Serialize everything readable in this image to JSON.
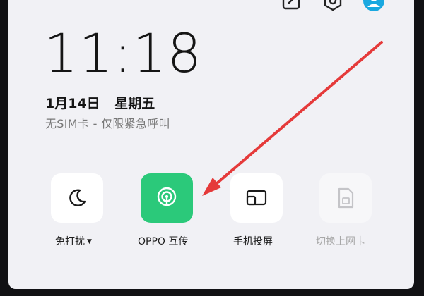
{
  "clock": {
    "time": "11:18"
  },
  "date": {
    "day": "1月14日",
    "weekday": "星期五"
  },
  "status": {
    "sim": "无SIM卡 - 仅限紧急呼叫"
  },
  "tiles": [
    {
      "label": "免打扰",
      "icon": "moon-icon",
      "has_dropdown": true,
      "enabled": true,
      "active": false
    },
    {
      "label": "OPPO 互传",
      "icon": "oppo-share-icon",
      "enabled": true,
      "active": true
    },
    {
      "label": "手机投屏",
      "icon": "screen-cast-icon",
      "enabled": true,
      "active": false
    },
    {
      "label": "切换上网卡",
      "icon": "sim-card-icon",
      "enabled": false,
      "active": false
    }
  ],
  "colors": {
    "panel_bg": "#f1f1f5",
    "tile_bg": "#ffffff",
    "active_tile_bg": "#2bc97a",
    "arrow": "#e53a3a",
    "avatar": "#1aa8e0"
  },
  "annotation": {
    "type": "arrow",
    "points_to": "oppo-share-tile"
  }
}
